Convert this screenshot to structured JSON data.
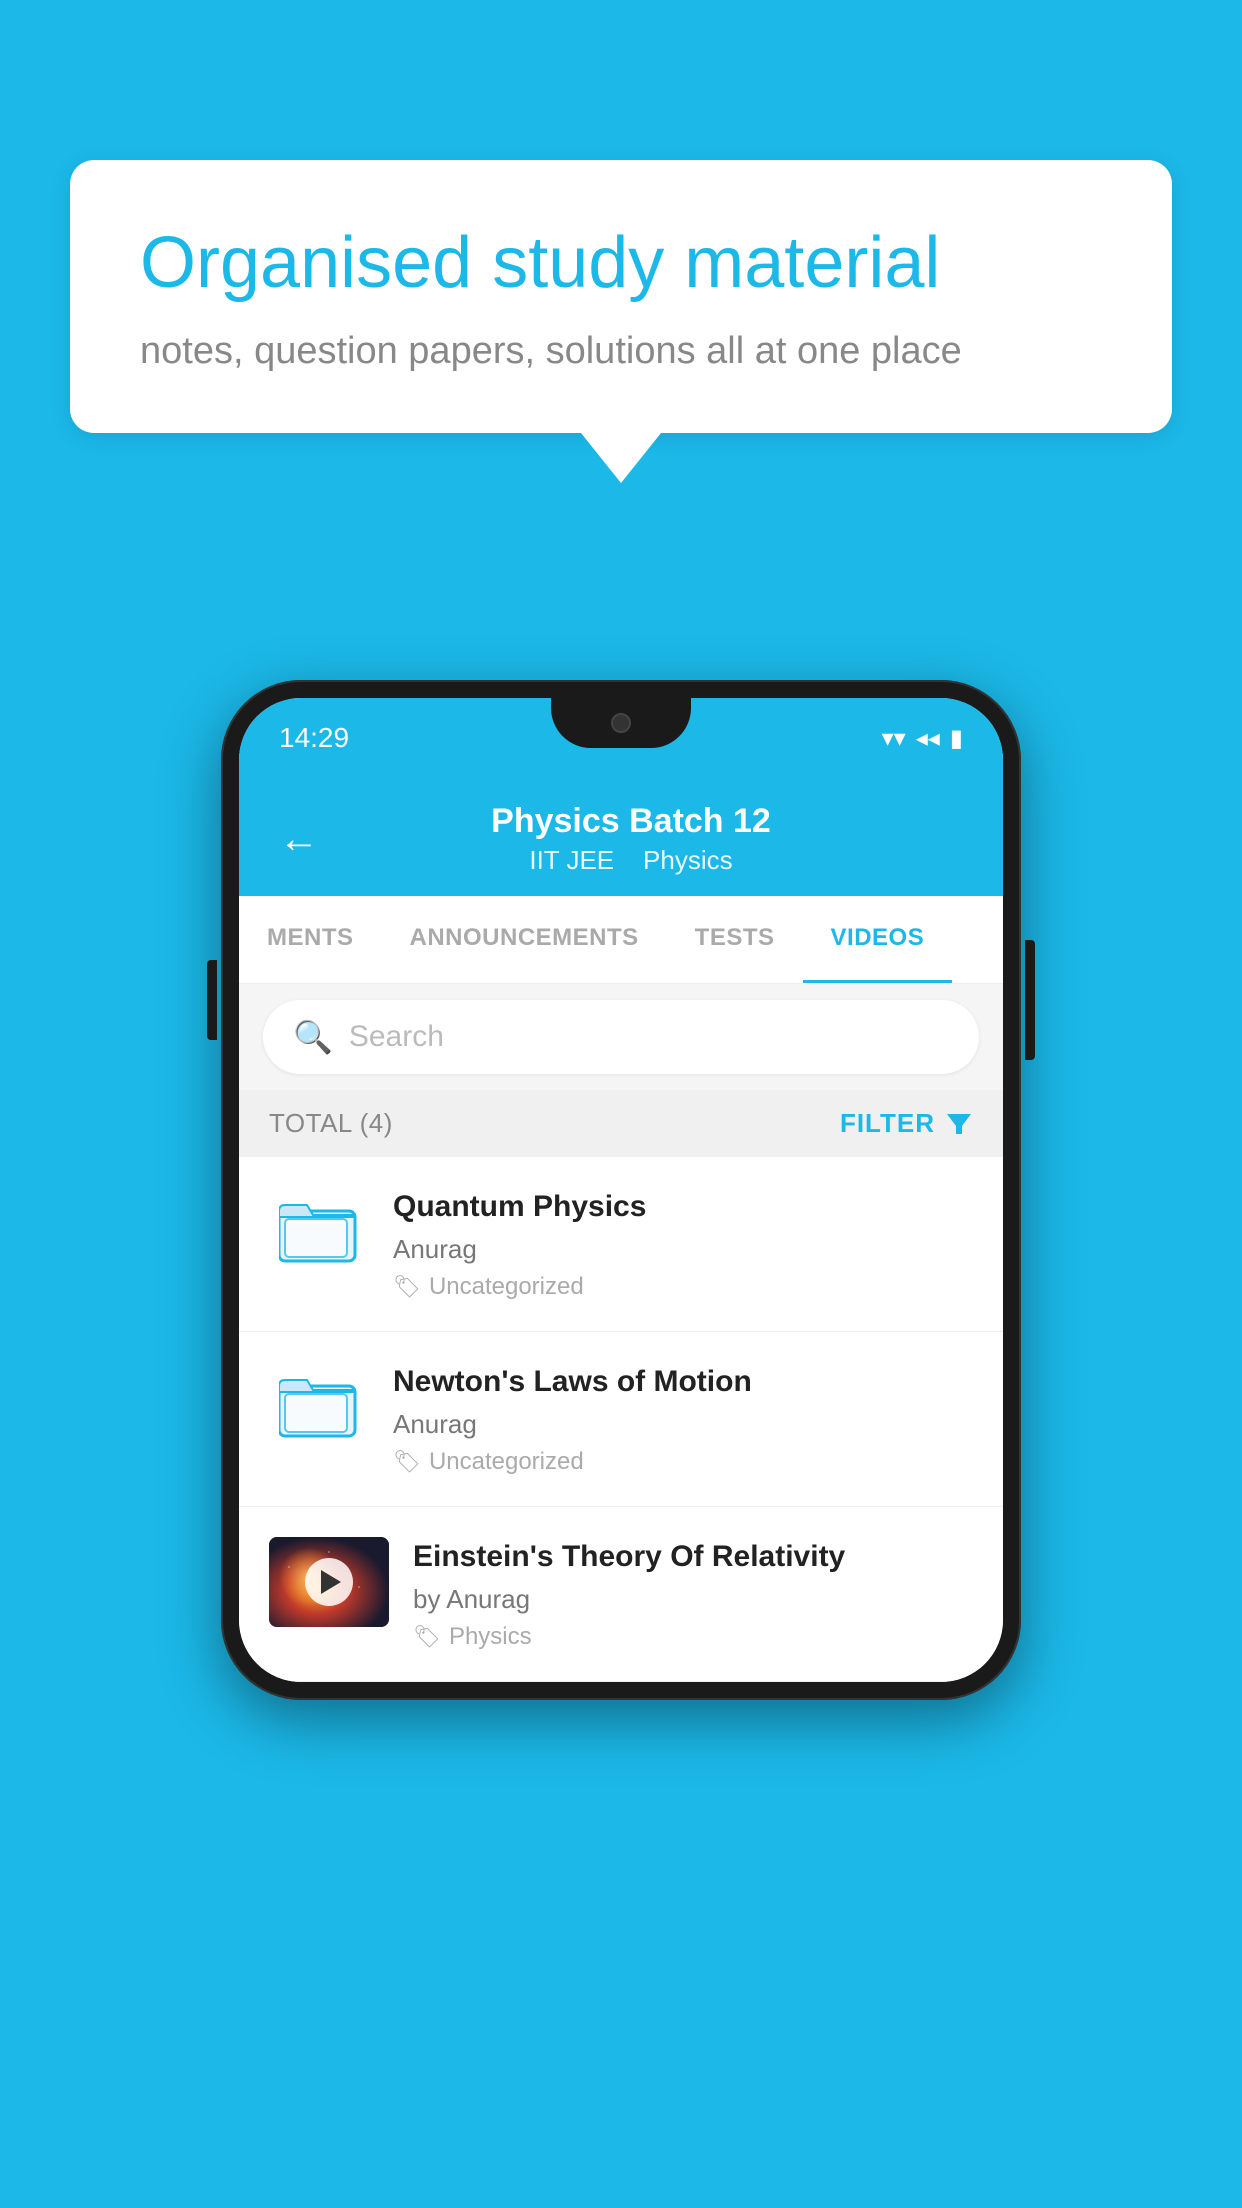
{
  "background_color": "#1bb8e8",
  "speech_bubble": {
    "title": "Organised study material",
    "subtitle": "notes, question papers, solutions all at one place"
  },
  "phone": {
    "status_bar": {
      "time": "14:29",
      "wifi": "▾",
      "signal": "◂",
      "battery": "▮"
    },
    "header": {
      "back_label": "←",
      "title": "Physics Batch 12",
      "subtitle_part1": "IIT JEE",
      "subtitle_part2": "Physics"
    },
    "tabs": [
      {
        "label": "MENTS",
        "active": false
      },
      {
        "label": "ANNOUNCEMENTS",
        "active": false
      },
      {
        "label": "TESTS",
        "active": false
      },
      {
        "label": "VIDEOS",
        "active": true
      }
    ],
    "search": {
      "placeholder": "Search"
    },
    "filter_bar": {
      "total_label": "TOTAL (4)",
      "filter_label": "FILTER"
    },
    "videos": [
      {
        "title": "Quantum Physics",
        "author": "Anurag",
        "tag": "Uncategorized",
        "type": "folder",
        "has_thumbnail": false
      },
      {
        "title": "Newton's Laws of Motion",
        "author": "Anurag",
        "tag": "Uncategorized",
        "type": "folder",
        "has_thumbnail": false
      },
      {
        "title": "Einstein's Theory Of Relativity",
        "author": "by Anurag",
        "tag": "Physics",
        "type": "video",
        "has_thumbnail": true
      }
    ]
  }
}
